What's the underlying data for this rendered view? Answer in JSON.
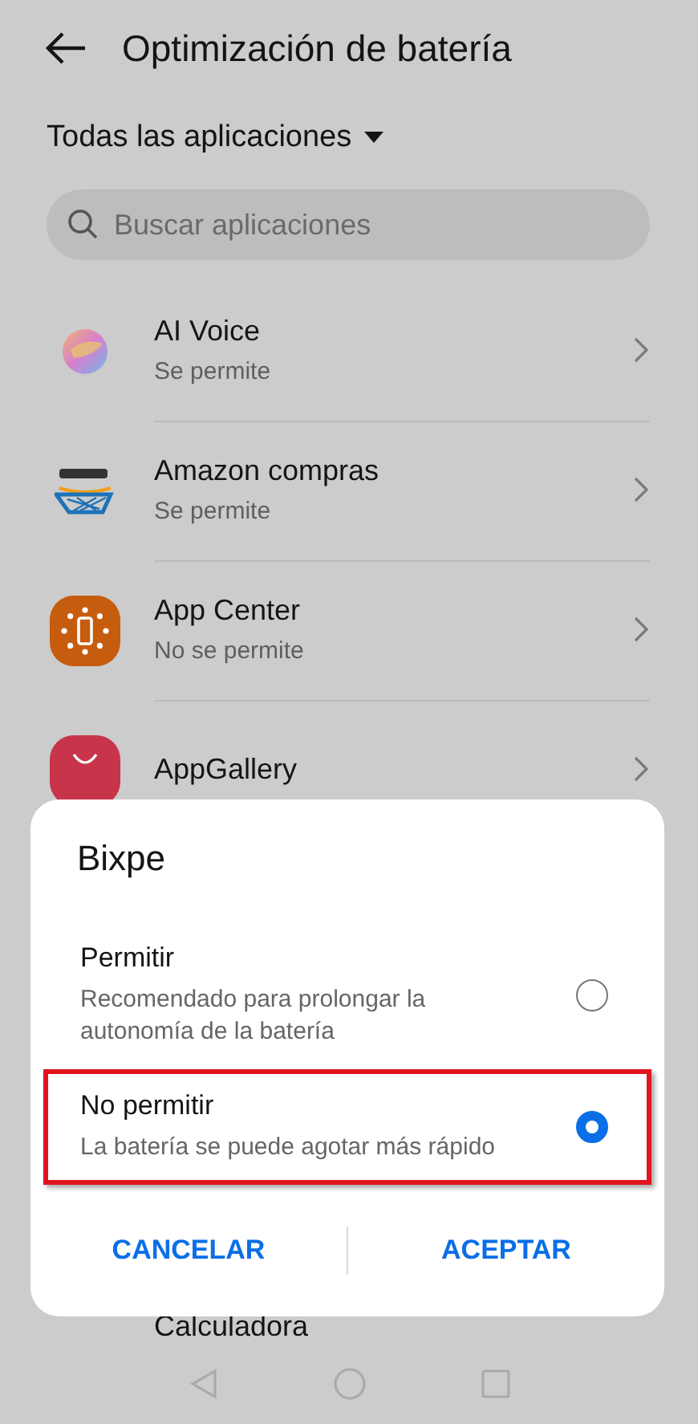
{
  "header": {
    "title": "Optimización de batería"
  },
  "filter": {
    "label": "Todas las aplicaciones"
  },
  "search": {
    "placeholder": "Buscar aplicaciones"
  },
  "apps": [
    {
      "kind": "voice",
      "name": "AI Voice",
      "status": "Se permite"
    },
    {
      "kind": "amazon",
      "name": "Amazon compras",
      "status": "Se permite"
    },
    {
      "kind": "center",
      "name": "App Center",
      "status": "No se permite"
    },
    {
      "kind": "gallery",
      "name": "AppGallery"
    }
  ],
  "apps_below": [
    {
      "name": "Calculadora"
    }
  ],
  "dialog": {
    "title": "Bixpe",
    "options": [
      {
        "label": "Permitir",
        "description": "Recomendado para prolongar la autonomía de la batería",
        "selected": false,
        "highlighted": false
      },
      {
        "label": "No permitir",
        "description": "La batería se puede agotar más rápido",
        "selected": true,
        "highlighted": true
      }
    ],
    "buttons": [
      "CANCELAR",
      "ACEPTAR"
    ]
  }
}
